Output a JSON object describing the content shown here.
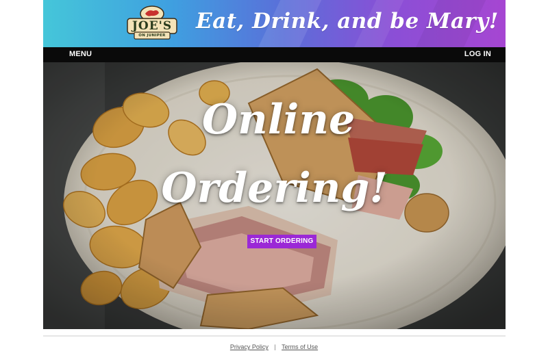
{
  "banner": {
    "logo_line1": "JOE'S",
    "logo_line2": "ON JUNIPER",
    "tagline": "Eat, Drink, and be Mary!"
  },
  "nav": {
    "menu_label": "MENU",
    "login_label": "LOG IN"
  },
  "hero": {
    "title_line1": "Online",
    "title_line2": "Ordering!",
    "cta_label": "START ORDERING"
  },
  "footer": {
    "privacy_label": "Privacy Policy",
    "separator": "|",
    "terms_label": "Terms of Use"
  },
  "colors": {
    "cta_background": "#9b28d6",
    "navbar_background": "#0a0a0a",
    "banner_gradient_start": "#45c6d9",
    "banner_gradient_end": "#a646d2"
  }
}
